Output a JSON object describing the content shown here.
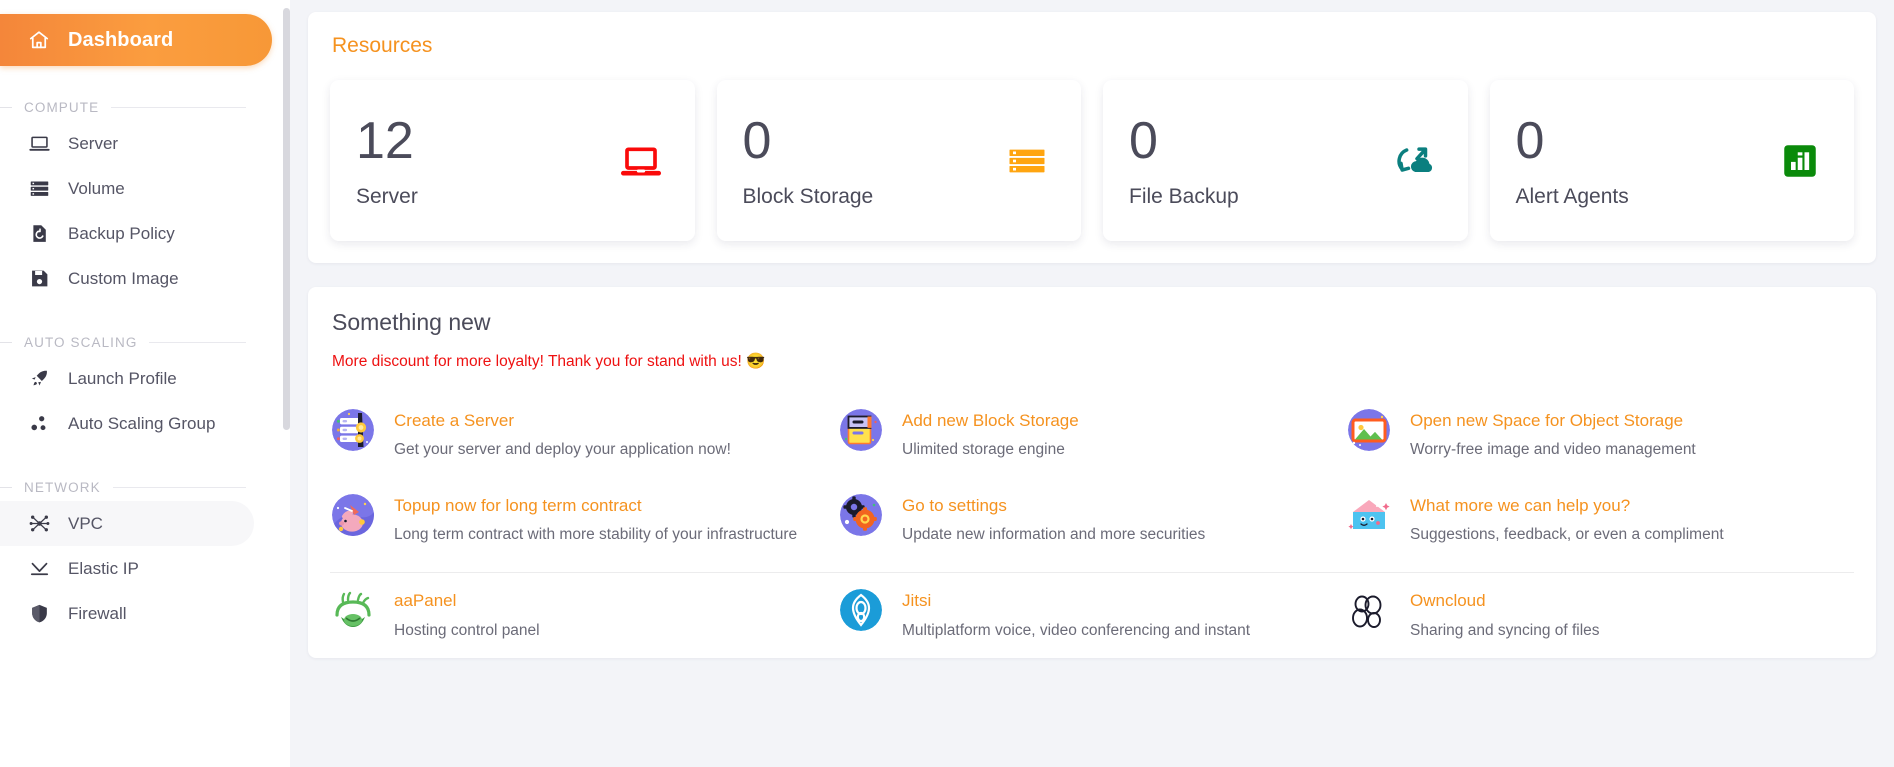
{
  "sidebar": {
    "active_item": {
      "label": "Dashboard",
      "icon": "home-icon"
    },
    "sections": [
      {
        "title": "COMPUTE",
        "items": [
          {
            "label": "Server",
            "icon": "laptop-icon"
          },
          {
            "label": "Volume",
            "icon": "stacked-disks-icon"
          },
          {
            "label": "Backup Policy",
            "icon": "backup-restore-icon"
          },
          {
            "label": "Custom Image",
            "icon": "floppy-disk-icon"
          }
        ]
      },
      {
        "title": "AUTO SCALING",
        "items": [
          {
            "label": "Launch Profile",
            "icon": "rocket-icon"
          },
          {
            "label": "Auto Scaling Group",
            "icon": "three-dots-group-icon"
          }
        ]
      },
      {
        "title": "NETWORK",
        "items": [
          {
            "label": "VPC",
            "icon": "network-hub-icon",
            "selected": true
          },
          {
            "label": "Elastic IP",
            "icon": "elastic-ip-icon"
          },
          {
            "label": "Firewall",
            "icon": "shield-icon"
          }
        ]
      }
    ]
  },
  "resources": {
    "title": "Resources",
    "cards": [
      {
        "value": "12",
        "label": "Server",
        "icon": "laptop-red-icon",
        "color": "#fa0a0a"
      },
      {
        "value": "0",
        "label": "Block Storage",
        "icon": "block-storage-orange-icon",
        "color": "#ffa510"
      },
      {
        "value": "0",
        "label": "File Backup",
        "icon": "cloud-sync-teal-icon",
        "color": "#0b7f7f"
      },
      {
        "value": "0",
        "label": "Alert Agents",
        "icon": "bar-chart-green-icon",
        "color": "#0a8a0a"
      }
    ]
  },
  "something_new": {
    "title": "Something new",
    "promo": "More discount for more loyalty! Thank you for stand with us! 😎",
    "promo_color": "#ee1111",
    "links": [
      {
        "title": "Create a Server",
        "desc": "Get your server and deploy your application now!",
        "icon": "server-rack-illustration-icon"
      },
      {
        "title": "Add new Block Storage",
        "desc": "Ulimited storage engine",
        "icon": "block-storage-illustration-icon"
      },
      {
        "title": "Open new Space for Object Storage",
        "desc": "Worry-free image and video management",
        "icon": "photo-frame-illustration-icon"
      },
      {
        "title": "Topup now for long term contract",
        "desc": "Long term contract with more stability of your infrastructure",
        "icon": "piggy-bank-illustration-icon"
      },
      {
        "title": "Go to settings",
        "desc": "Update new information and more securities",
        "icon": "gears-illustration-icon"
      },
      {
        "title": "What more we can help you?",
        "desc": "Suggestions, feedback, or even a compliment",
        "icon": "mailbox-illustration-icon"
      },
      {
        "title": "aaPanel",
        "desc": "Hosting control panel",
        "icon": "aapanel-logo-icon"
      },
      {
        "title": "Jitsi",
        "desc": "Multiplatform voice, video conferencing and instant",
        "icon": "jitsi-logo-icon"
      },
      {
        "title": "Owncloud",
        "desc": "Sharing and syncing of files",
        "icon": "owncloud-logo-icon"
      }
    ]
  }
}
